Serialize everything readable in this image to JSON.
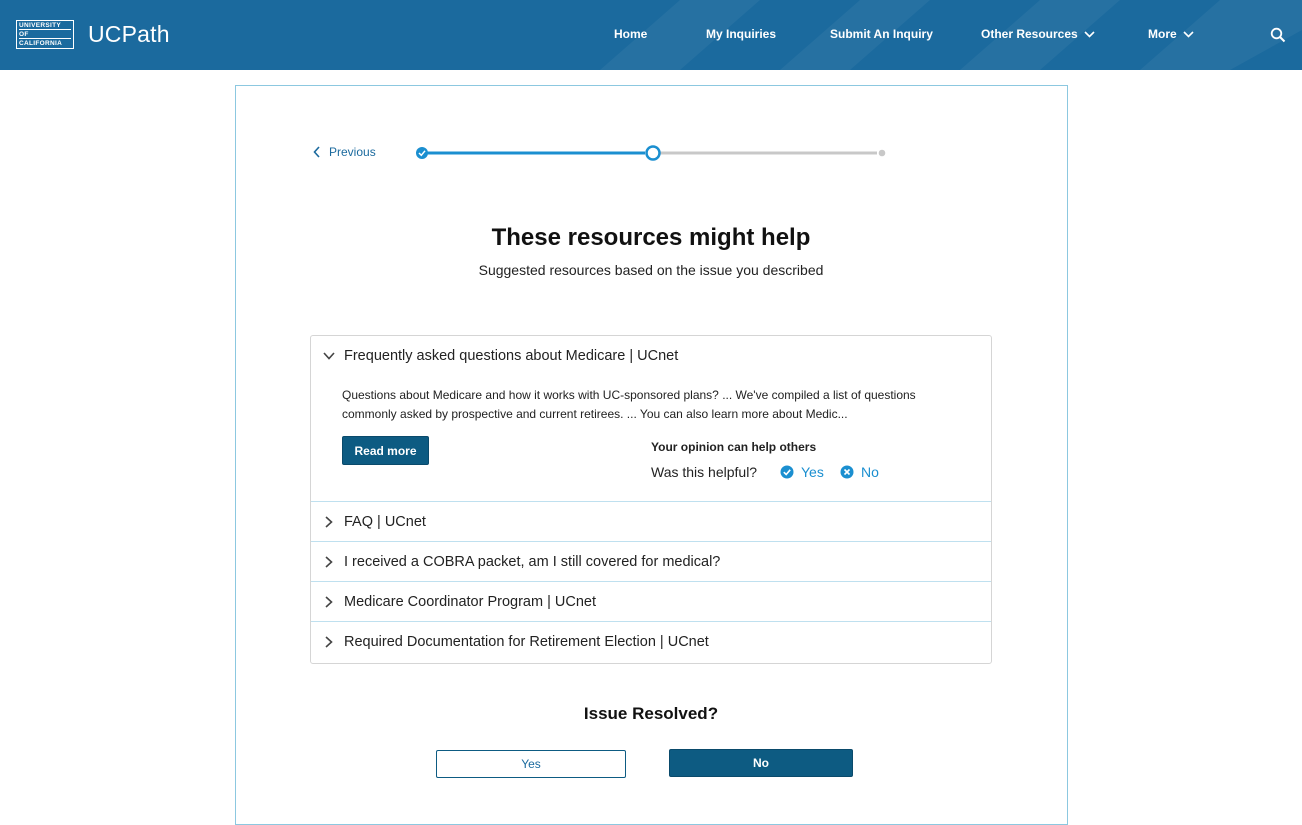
{
  "header": {
    "logo_lines": [
      "UNIVERSITY",
      "OF",
      "CALIFORNIA"
    ],
    "app_name": "UCPath",
    "nav": [
      {
        "label": "Home"
      },
      {
        "label": "My Inquiries"
      },
      {
        "label": "Submit An Inquiry"
      },
      {
        "label": "Other Resources"
      },
      {
        "label": "More"
      }
    ],
    "search_icon": "search-icon"
  },
  "wizard": {
    "previous_label": "Previous",
    "total_steps": 3,
    "current_step": 2
  },
  "page": {
    "title": "These resources might help",
    "subtitle": "Suggested resources based on the issue you described"
  },
  "resources": [
    {
      "title": "Frequently asked questions about Medicare | UCnet",
      "expanded": true,
      "description_line1": "Questions about Medicare and how it works with UC-sponsored plans? ... We've compiled a list of questions",
      "description_line2": "commonly asked by prospective and current retirees. ... You can also learn more about Medic...",
      "read_more": "Read more",
      "opinion_title": "Your opinion can help others",
      "helpful_question": "Was this helpful?",
      "yes": "Yes",
      "no": "No"
    },
    {
      "title": "FAQ | UCnet",
      "expanded": false
    },
    {
      "title": "I received a COBRA packet, am I still covered for medical?",
      "expanded": false
    },
    {
      "title": "Medicare Coordinator Program | UCnet",
      "expanded": false
    },
    {
      "title": "Required Documentation for Retirement Election | UCnet",
      "expanded": false
    }
  ],
  "resolution": {
    "question": "Issue Resolved?",
    "yes": "Yes",
    "no": "No"
  },
  "colors": {
    "header_bg": "#1b6a9e",
    "primary_button": "#0d5b82",
    "link": "#1b8fd0",
    "progress_active": "#1b8fd0",
    "progress_inactive": "#c8c8c8"
  }
}
